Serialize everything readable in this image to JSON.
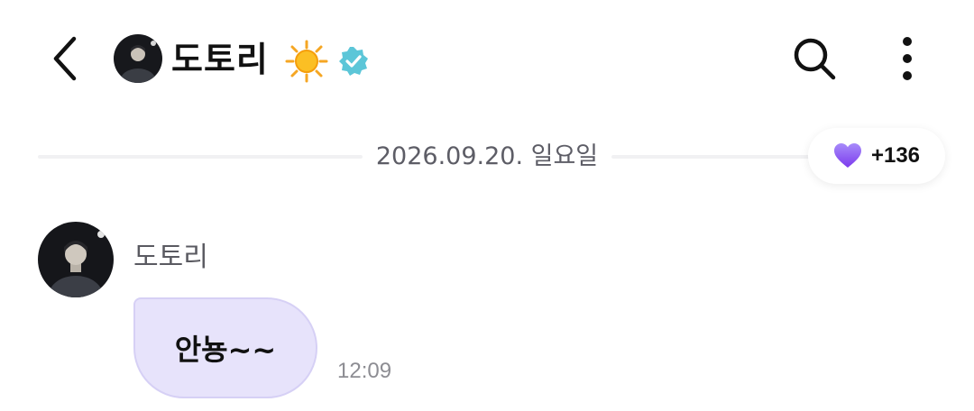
{
  "header": {
    "title": "도토리",
    "back_icon": "chevron-left-icon",
    "status_icon": "sun-icon",
    "verified_icon": "verified-badge-icon",
    "search_icon": "search-icon",
    "more_icon": "more-vertical-icon"
  },
  "date_divider": {
    "text": "2026.09.20. 일요일"
  },
  "reaction_badge": {
    "icon": "heart-icon",
    "count": "+136",
    "heart_color": "#8b5cf6"
  },
  "message": {
    "sender": "도토리",
    "text": "안뇽~~",
    "time": "12:09",
    "bubble_color": "#e7e3fb"
  }
}
